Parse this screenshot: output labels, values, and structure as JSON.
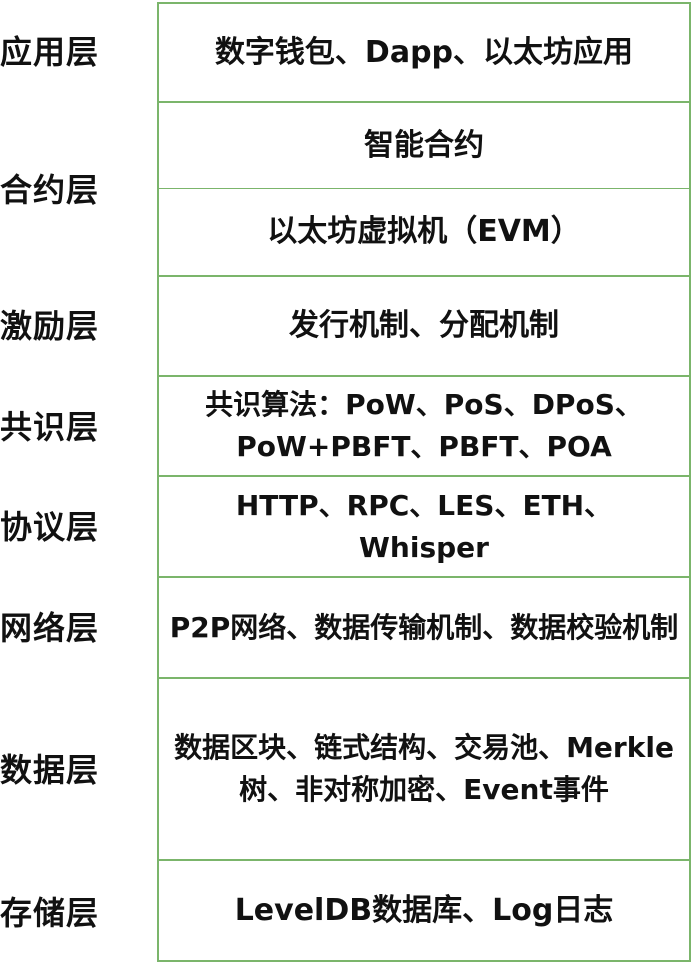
{
  "layers": [
    {
      "name": "应用层",
      "items": [
        "数字钱包、Dapp、以太坊应用"
      ]
    },
    {
      "name": "合约层",
      "items": [
        "智能合约",
        "以太坊虚拟机（EVM）"
      ]
    },
    {
      "name": "激励层",
      "items": [
        "发行机制、分配机制"
      ]
    },
    {
      "name": "共识层",
      "items": [
        "共识算法：PoW、PoS、DPoS、PoW+PBFT、PBFT、POA"
      ]
    },
    {
      "name": "协议层",
      "items": [
        "HTTP、RPC、LES、ETH、Whisper"
      ]
    },
    {
      "name": "网络层",
      "items": [
        "P2P网络、数据传输机制、数据校验机制"
      ]
    },
    {
      "name": "数据层",
      "items": [
        "数据区块、链式结构、交易池、Merkle树、非对称加密、Event事件"
      ]
    },
    {
      "name": "存储层",
      "items": [
        "LevelDB数据库、Log日志"
      ]
    }
  ],
  "colors": {
    "border": "#7bb56b",
    "text": "#111111",
    "background": "#ffffff"
  }
}
